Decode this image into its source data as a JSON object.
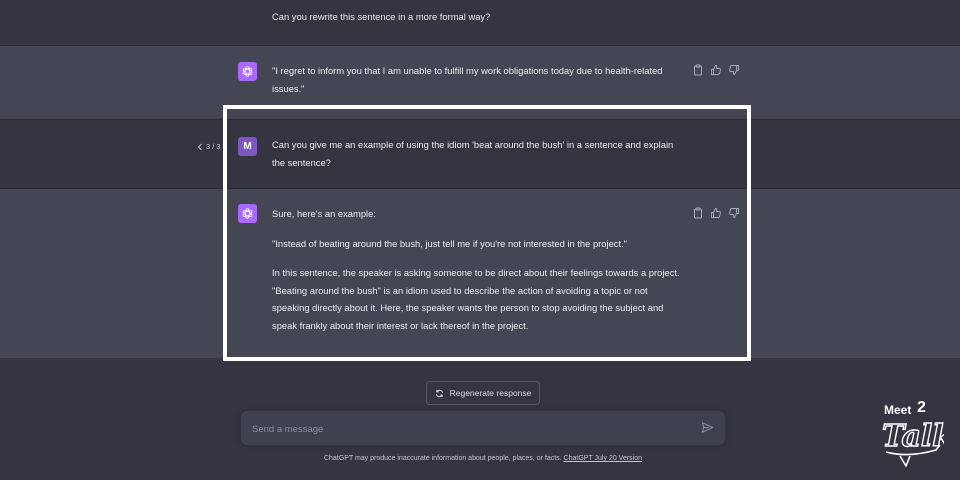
{
  "conversation": {
    "prev_user_message": "Can you rewrite this sentence in a more formal way?",
    "prev_assistant_message": "\"I regret to inform you that I am unable to fulfill my work obligations today due to health-related issues.\"",
    "user_message": "Can you give me an example of using the idiom 'beat around the bush' in a sentence and explain the sentence?",
    "user_avatar_initial": "M",
    "pager": "3 / 3",
    "assistant_reply": {
      "p1": "Sure, here's an example:",
      "p2": "\"Instead of beating around the bush, just tell me if you're not interested in the project.\"",
      "p3": "In this sentence, the speaker is asking someone to be direct about their feelings towards a project. \"Beating around the bush\" is an idiom used to describe the action of avoiding a topic or not speaking directly about it. Here, the speaker wants the person to stop avoiding the subject and speak frankly about their interest or lack thereof in the project."
    }
  },
  "controls": {
    "regenerate_label": "Regenerate response",
    "input_placeholder": "Send a message"
  },
  "footer": {
    "disclaimer": "ChatGPT may produce inaccurate information about people, places, or facts.",
    "version_link": "ChatGPT July 20 Version"
  },
  "watermark": {
    "line1": "Meet",
    "superscript": "2",
    "line2": "Talk"
  },
  "icons": {
    "sidebar": "sidebar-toggle-icon",
    "gpt": "openai-logo-icon",
    "copy": "clipboard-icon",
    "like": "thumbs-up-icon",
    "dislike": "thumbs-down-icon",
    "regenerate": "refresh-icon",
    "send": "send-icon",
    "pager_prev": "chevron-left-icon"
  },
  "colors": {
    "background": "#343541",
    "assistant_row": "#444654",
    "gpt_avatar": "#ab68ff",
    "user_avatar": "#7e57c2",
    "highlight": "#ffffff"
  }
}
